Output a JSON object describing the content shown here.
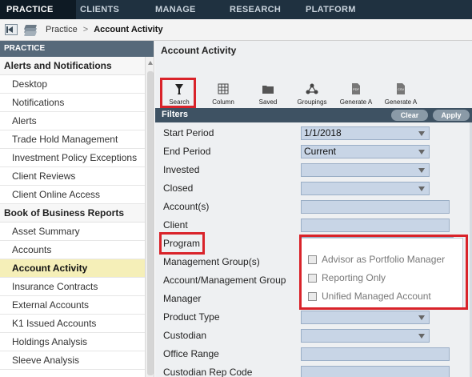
{
  "topnav": {
    "tabs": [
      {
        "label": "PRACTICE"
      },
      {
        "label": "CLIENTS"
      },
      {
        "label": "MANAGE"
      },
      {
        "label": "RESEARCH"
      },
      {
        "label": "PLATFORM"
      }
    ]
  },
  "breadcrumb": {
    "parent": "Practice",
    "sep": ">",
    "current": "Account Activity"
  },
  "sidebar": {
    "header": "PRACTICE",
    "group1": "Alerts and Notifications",
    "items1": [
      "Desktop",
      "Notifications",
      "Alerts",
      "Trade Hold Management",
      "Investment Policy Exceptions",
      "Client Reviews",
      "Client Online Access"
    ],
    "group2": "Book of Business Reports",
    "items2": [
      "Asset Summary",
      "Accounts",
      "Account Activity",
      "Insurance Contracts",
      "External Accounts",
      "K1 Issued Accounts",
      "Holdings Analysis",
      "Sleeve Analysis"
    ]
  },
  "main": {
    "title": "Account Activity",
    "tools": [
      {
        "label": "Search",
        "icon": "filter-icon"
      },
      {
        "label": "Column",
        "icon": "grid-icon"
      },
      {
        "label": "Saved",
        "icon": "folder-icon"
      },
      {
        "label": "Groupings",
        "icon": "network-icon"
      },
      {
        "label": "Generate A",
        "icon": "pdf-icon",
        "badge": "PDF"
      },
      {
        "label": "Generate A",
        "icon": "csv-icon",
        "badge": "CSV"
      }
    ],
    "filters_title": "Filters",
    "clear_label": "Clear",
    "apply_label": "Apply",
    "rows": [
      {
        "label": "Start Period",
        "value": "1/1/2018"
      },
      {
        "label": "End Period",
        "value": "Current"
      },
      {
        "label": "Invested",
        "value": ""
      },
      {
        "label": "Closed",
        "value": ""
      },
      {
        "label": "Account(s)",
        "value": ""
      },
      {
        "label": "Client",
        "value": ""
      },
      {
        "label": "Program",
        "value": ""
      },
      {
        "label": "Management Group(s)",
        "value": ""
      },
      {
        "label": "Account/Management Group",
        "value": ""
      },
      {
        "label": "Manager",
        "value": ""
      },
      {
        "label": "Product Type",
        "value": ""
      },
      {
        "label": "Custodian",
        "value": ""
      },
      {
        "label": "Office Range",
        "value": ""
      },
      {
        "label": "Custodian Rep Code",
        "value": ""
      }
    ],
    "program_options": [
      "Advisor as Portfolio Manager",
      "Reporting Only",
      "Unified Managed Account"
    ]
  }
}
